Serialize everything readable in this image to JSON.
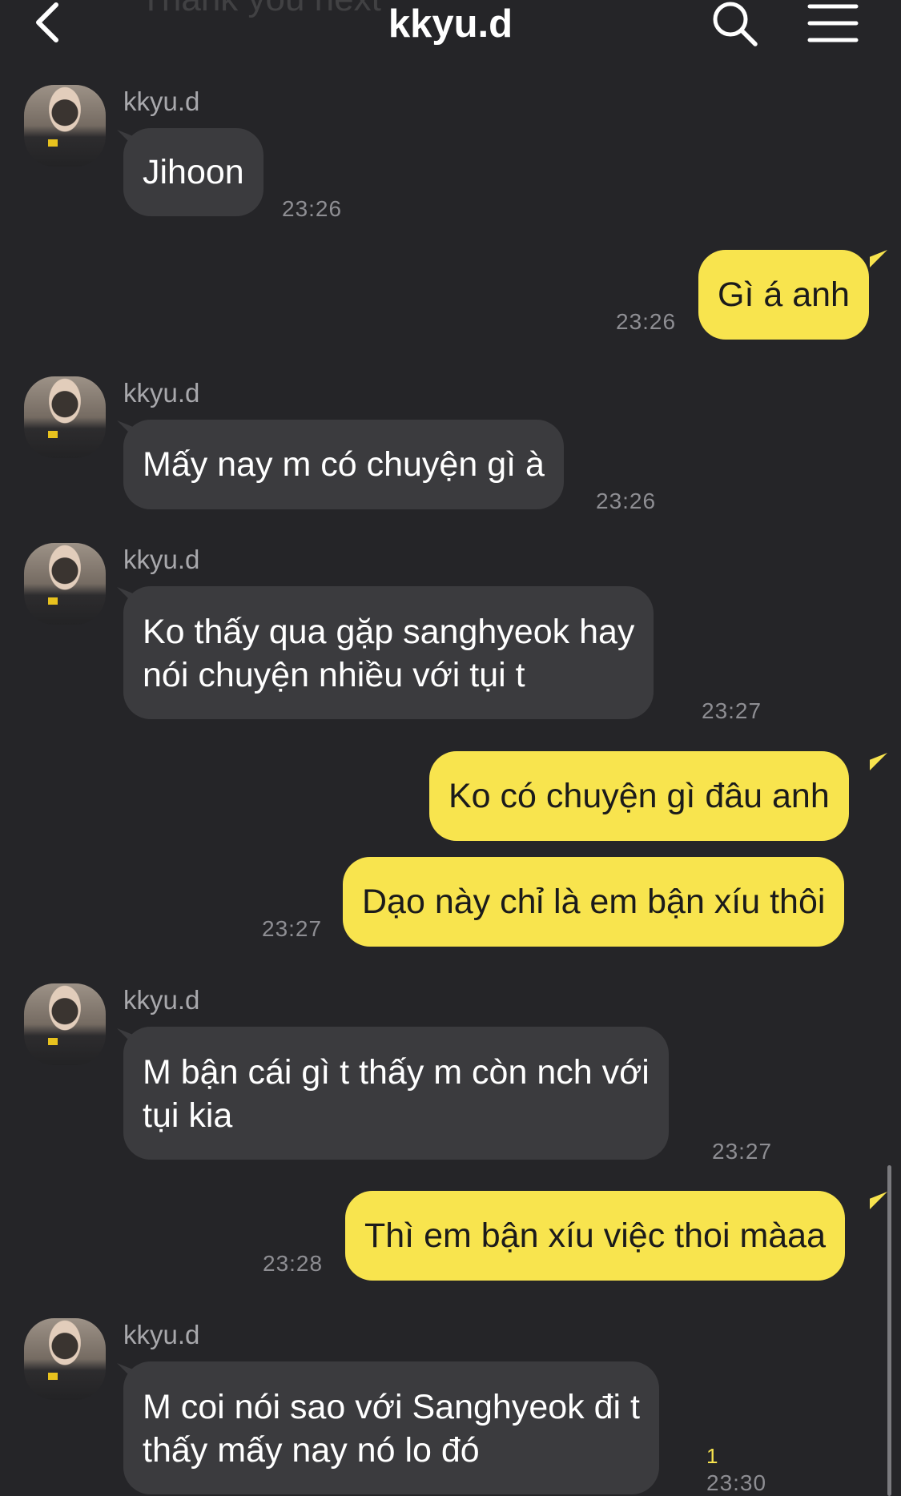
{
  "header": {
    "ghost_text": "Thank you next",
    "title": "kkyu.d",
    "back_icon": "chevron-left-icon",
    "search_icon": "search-icon",
    "menu_icon": "menu-icon"
  },
  "colors": {
    "background": "#252528",
    "incoming_bubble": "#3b3b3e",
    "outgoing_bubble": "#f8e44e",
    "timestamp": "#8e8e93"
  },
  "messages": [
    {
      "sender": "kkyu.d",
      "text": "Jihoon",
      "time": "23:26"
    },
    {
      "text": "Gì á anh",
      "time": "23:26"
    },
    {
      "sender": "kkyu.d",
      "text": "Mấy nay m có chuyện gì à",
      "time": "23:26"
    },
    {
      "sender": "kkyu.d",
      "line1": "Ko thấy qua gặp sanghyeok hay",
      "line2": "nói chuyện nhiều với tụi t",
      "time": "23:27"
    },
    {
      "text": "Ko có chuyện gì đâu anh"
    },
    {
      "text": "Dạo này chỉ là em bận xíu thôi",
      "time": "23:27"
    },
    {
      "sender": "kkyu.d",
      "line1": "M bận cái gì t thấy m còn nch với",
      "line2": "tụi kia",
      "time": "23:27"
    },
    {
      "text": "Thì em bận xíu việc thoi màaa",
      "time": "23:28"
    },
    {
      "sender": "kkyu.d",
      "line1": "M coi nói sao với Sanghyeok đi t",
      "line2": "thấy mấy nay nó lo đó",
      "time": "23:30",
      "unread": "1"
    }
  ]
}
